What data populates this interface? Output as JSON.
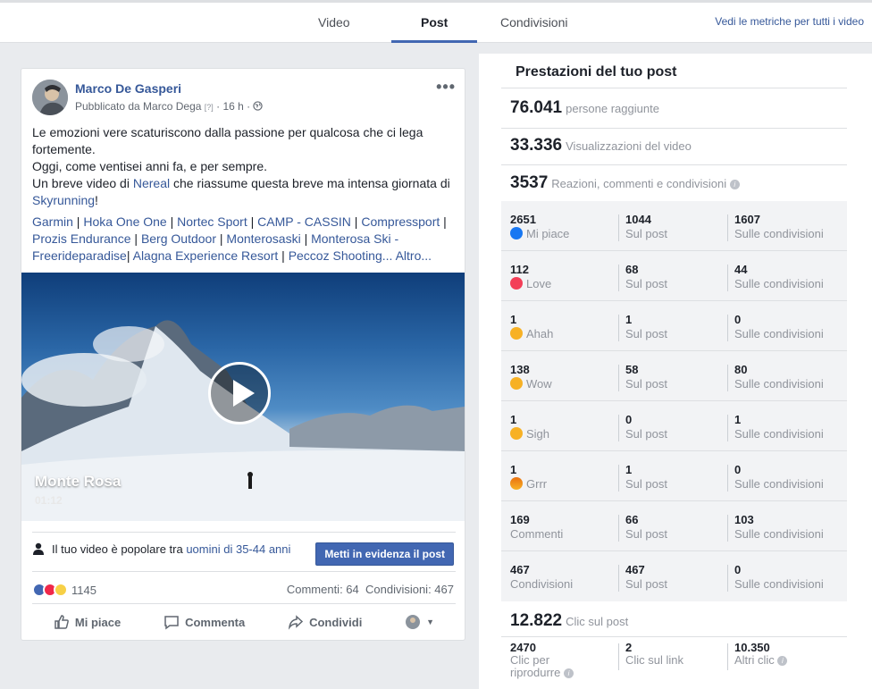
{
  "tabs": [
    {
      "label": "Video"
    },
    {
      "label": "Post"
    },
    {
      "label": "Condivisioni"
    }
  ],
  "tab_link": "Vedi le metriche per tutti i video",
  "post": {
    "author": "Marco De Gasperi",
    "published_by": "Pubblicato da Marco Dega",
    "help_mark": "[?]",
    "time": "· 16 h ·",
    "text": {
      "line1": "Le emozioni vere scaturiscono dalla passione per qualcosa che ci lega fortemente.",
      "line2": "Oggi, come ventisei anni fa, e per sempre.",
      "line3_pre": "Un breve video di ",
      "line3_link": "Nereal",
      "line3_post": " che riassume questa breve ma intensa giornata di ",
      "line3_link2": "Skyrunning",
      "line3_end": "!"
    },
    "tags": [
      "Garmin",
      "Hoka One One",
      "Nortec Sport",
      "CAMP - CASSIN",
      "Compressport",
      "Prozis Endurance",
      "Berg Outdoor",
      "Monterosaski",
      "Monterosa Ski - Freerideparadise",
      "Alagna Experience Resort",
      "Peccoz Shooting..."
    ],
    "more": "Altro...",
    "video": {
      "title": "Monte Rosa",
      "duration": "01:12"
    },
    "popular_pre": "Il tuo video è popolare tra ",
    "popular_link": "uomini di 35-44 anni",
    "boost_label": "Metti in evidenza il post",
    "reactions_count": "1145",
    "comments": "Commenti: 64",
    "shares": "Condivisioni: 467",
    "actions": {
      "like": "Mi piace",
      "comment": "Commenta",
      "share": "Condividi"
    }
  },
  "panel": {
    "title": "Prestazioni del tuo post",
    "reach": {
      "value": "76.041",
      "label": "persone raggiunte"
    },
    "views": {
      "value": "33.336",
      "label": "Visualizzazioni del video"
    },
    "engagement": {
      "value": "3537",
      "label": "Reazioni, commenti e condivisioni"
    },
    "rows": [
      {
        "total": "2651",
        "label": "Mi piace",
        "icon": "like-icon",
        "post": "1044",
        "post_label": "Sul post",
        "shares": "1607",
        "shares_label": "Sulle condivisioni"
      },
      {
        "total": "112",
        "label": "Love",
        "icon": "love-icon",
        "post": "68",
        "post_label": "Sul post",
        "shares": "44",
        "shares_label": "Sulle condivisioni"
      },
      {
        "total": "1",
        "label": "Ahah",
        "icon": "haha-icon",
        "post": "1",
        "post_label": "Sul post",
        "shares": "0",
        "shares_label": "Sulle condivisioni"
      },
      {
        "total": "138",
        "label": "Wow",
        "icon": "wow-icon",
        "post": "58",
        "post_label": "Sul post",
        "shares": "80",
        "shares_label": "Sulle condivisioni"
      },
      {
        "total": "1",
        "label": "Sigh",
        "icon": "sad-icon",
        "post": "0",
        "post_label": "Sul post",
        "shares": "1",
        "shares_label": "Sulle condivisioni"
      },
      {
        "total": "1",
        "label": "Grrr",
        "icon": "angry-icon",
        "post": "1",
        "post_label": "Sul post",
        "shares": "0",
        "shares_label": "Sulle condivisioni"
      },
      {
        "total": "169",
        "label": "Commenti",
        "icon": "",
        "post": "66",
        "post_label": "Sul post",
        "shares": "103",
        "shares_label": "Sulle condivisioni"
      },
      {
        "total": "467",
        "label": "Condivisioni",
        "icon": "",
        "post": "467",
        "post_label": "Sul post",
        "shares": "0",
        "shares_label": "Sulle condivisioni"
      }
    ],
    "clicks": {
      "value": "12.822",
      "label": "Clic sul post"
    },
    "click_breakdown": [
      {
        "value": "2470",
        "label1": "Clic per",
        "label2": "riprodurre"
      },
      {
        "value": "2",
        "label1": "Clic sul link",
        "label2": ""
      },
      {
        "value": "10.350",
        "label1": "Altri clic",
        "label2": ""
      }
    ]
  }
}
